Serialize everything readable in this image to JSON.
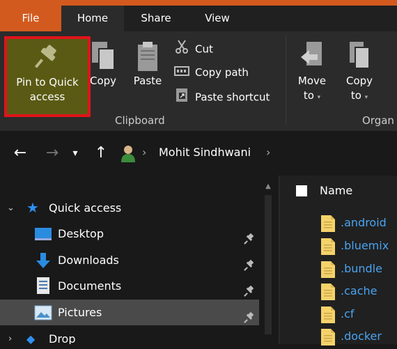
{
  "tabs": {
    "file": "File",
    "home": "Home",
    "share": "Share",
    "view": "View"
  },
  "ribbon": {
    "pin_label_line1": "Pin to Quick",
    "pin_label_line2": "access",
    "copy": "Copy",
    "paste": "Paste",
    "cut": "Cut",
    "copy_path": "Copy path",
    "paste_shortcut": "Paste shortcut",
    "move_to_line1": "Move",
    "move_to_line2": "to",
    "copy_to_line1": "Copy",
    "copy_to_line2": "to",
    "clipboard_group": "Clipboard",
    "organize_group": "Organ"
  },
  "address": {
    "location": "Mohit Sindhwani"
  },
  "nav": {
    "quick_access": "Quick access",
    "items": [
      {
        "label": "Desktop"
      },
      {
        "label": "Downloads"
      },
      {
        "label": "Documents"
      },
      {
        "label": "Pictures"
      }
    ],
    "partial_next": "Drop"
  },
  "list": {
    "header": "Name",
    "files": [
      ".android",
      ".bluemix",
      ".bundle",
      ".cache",
      ".cf",
      ".docker"
    ]
  },
  "colors": {
    "file_tab": "#d35a1e",
    "highlight_box": "#e0141a",
    "pin_bg": "#5a5a14",
    "link_blue": "#4aa3f0",
    "folder_yellow": "#f5d36b"
  }
}
